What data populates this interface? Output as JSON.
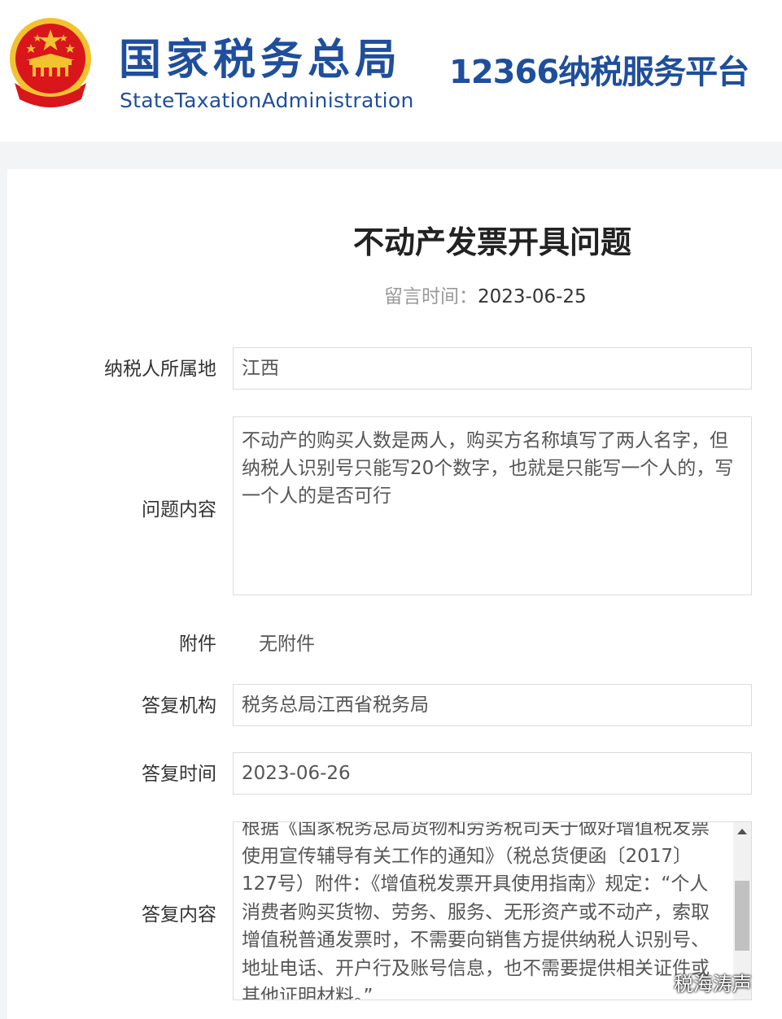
{
  "header": {
    "brand_cn": "国家税务总局",
    "brand_en": "StateTaxationAdministration",
    "platform": "12366纳税服务平台"
  },
  "question": {
    "title": "不动产发票开具问题",
    "message_time_label": "留言时间：",
    "message_time": "2023-06-25"
  },
  "form": {
    "location_label": "纳税人所属地",
    "location_value": "江西",
    "content_label": "问题内容",
    "content_value": "不动产的购买人数是两人，购买方名称填写了两人名字，但纳税人识别号只能写20个数字，也就是只能写一个人的，写一个人的是否可行",
    "attachment_label": "附件",
    "attachment_value": "无附件",
    "agency_label": "答复机构",
    "agency_value": "税务总局江西省税务局",
    "reply_time_label": "答复时间",
    "reply_time_value": "2023-06-26",
    "reply_content_label": "答复内容",
    "reply_content_value": "根据《国家税务总局货物和劳务税司关于做好增值税发票使用宣传辅导有关工作的通知》（税总货便函〔2017〕127号）附件：《增值税发票开具使用指南》规定：“个人消费者购买货物、劳务、服务、无形资产或不动产，索取增值税普通发票时，不需要向销售方提供纳税人识别号、地址电话、开户行及账号信息，也不需要提供相关证件或其他证明材料。”"
  },
  "watermark": {
    "text": "税海涛声"
  },
  "colors": {
    "brand_blue": "#1f4e9c",
    "emblem_red": "#d8161b",
    "emblem_gold": "#f2c230"
  }
}
